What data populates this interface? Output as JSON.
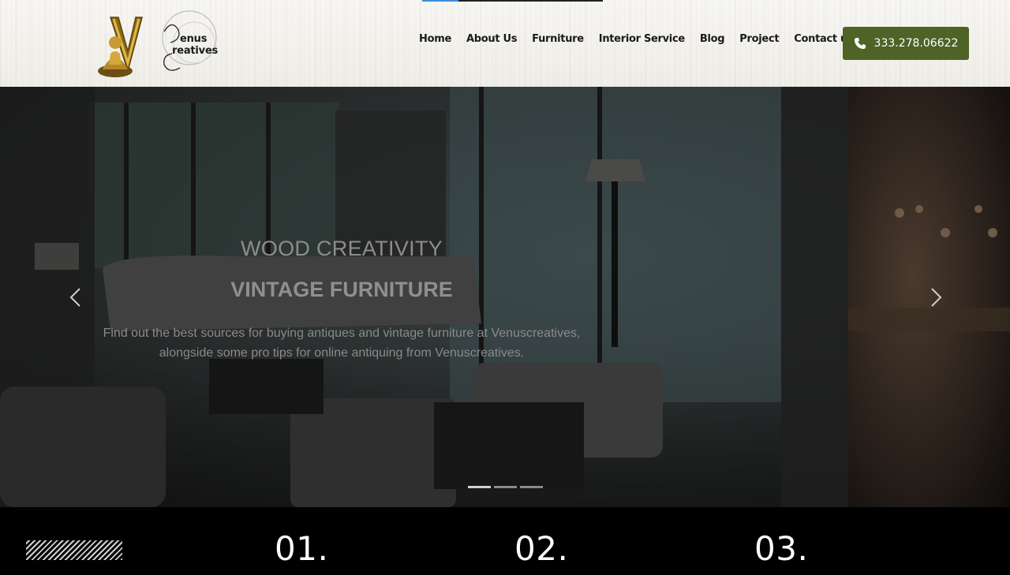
{
  "header": {
    "brand": {
      "line1": "enus",
      "line2": "reatives"
    },
    "nav": [
      "Home",
      "About Us",
      "Furniture",
      "Interior Service",
      "Blog",
      "Project",
      "Contact us"
    ],
    "phone": "333.278.06622",
    "slide_progress": 0.2
  },
  "hero": {
    "title": "WOOD CREATIVITY",
    "heading": "VINTAGE FURNITURE",
    "description": "Find out the best sources for buying antiques and vintage furniture at Venuscreatives, alongside some pro tips for online antiquing from Venuscreatives.",
    "slide_count": 3,
    "active_slide": 0
  },
  "features": {
    "numbers": [
      "01.",
      "02.",
      "03."
    ]
  },
  "colors": {
    "accent": "#4e6427",
    "progress": "#3a8fd8"
  },
  "icons": [
    "phone-icon",
    "chevron-left-icon",
    "chevron-right-icon",
    "buddha-icon"
  ]
}
